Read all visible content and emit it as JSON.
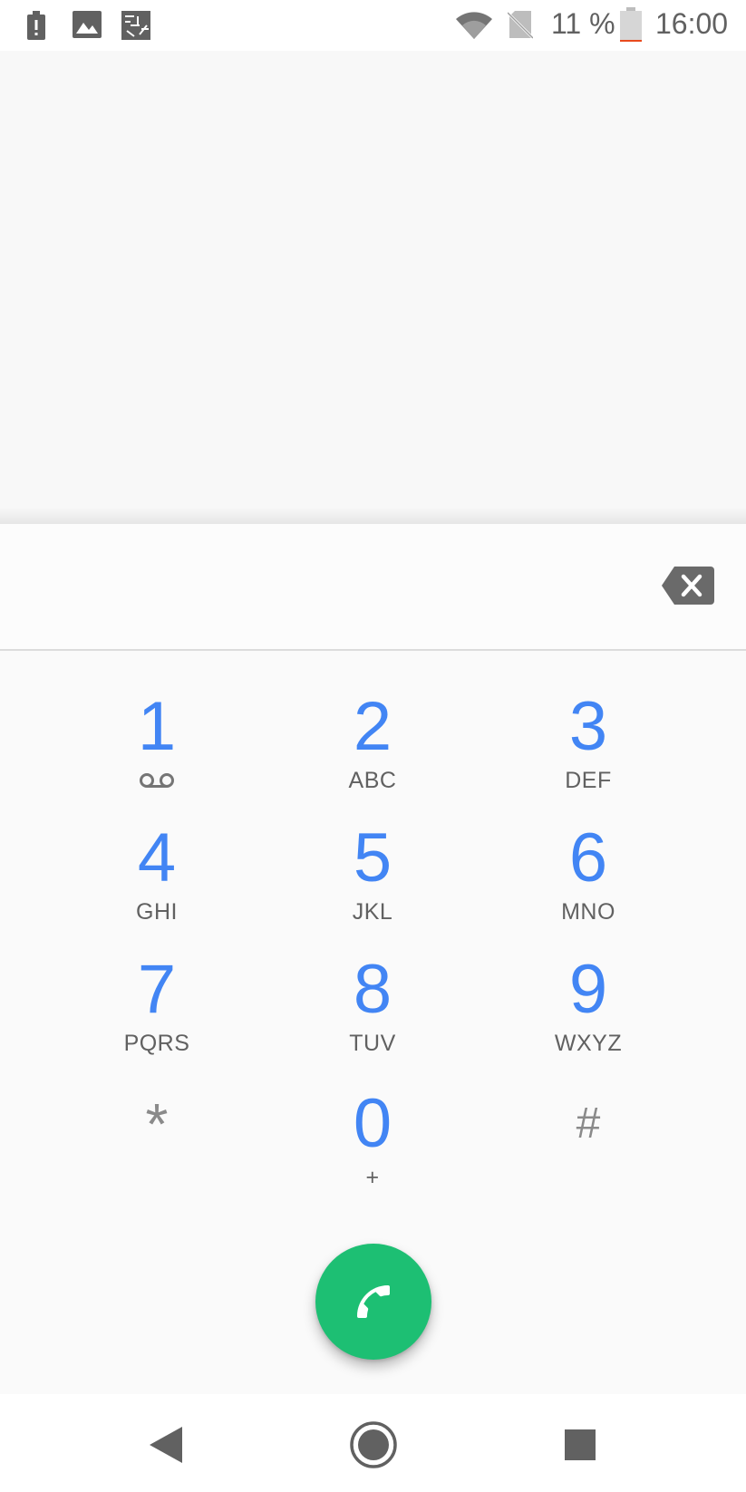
{
  "status_bar": {
    "icons_left": [
      "battery-alert-icon",
      "image-icon",
      "sim-card-icon"
    ],
    "icons_right": [
      "wifi-icon",
      "no-sim-icon",
      "battery-low-icon"
    ],
    "battery_percent": "11 %",
    "time": "16:00",
    "battery_level": 0.11,
    "battery_warning_color": "#e8491d"
  },
  "dialer": {
    "digits": "",
    "backspace_icon": "backspace-icon",
    "keys": [
      {
        "num": "1",
        "sub": "",
        "sub_icon": "voicemail-icon"
      },
      {
        "num": "2",
        "sub": "ABC"
      },
      {
        "num": "3",
        "sub": "DEF"
      },
      {
        "num": "4",
        "sub": "GHI"
      },
      {
        "num": "5",
        "sub": "JKL"
      },
      {
        "num": "6",
        "sub": "MNO"
      },
      {
        "num": "7",
        "sub": "PQRS"
      },
      {
        "num": "8",
        "sub": "TUV"
      },
      {
        "num": "9",
        "sub": "WXYZ"
      },
      {
        "num": "*",
        "sub": ""
      },
      {
        "num": "0",
        "sub": "+"
      },
      {
        "num": "#",
        "sub": ""
      }
    ],
    "call_button_icon": "phone-icon",
    "accent_color": "#4285f4",
    "call_color": "#1dbf73"
  },
  "nav_bar": {
    "back_icon": "back-triangle-icon",
    "home_icon": "home-circle-icon",
    "recents_icon": "recents-square-icon"
  }
}
